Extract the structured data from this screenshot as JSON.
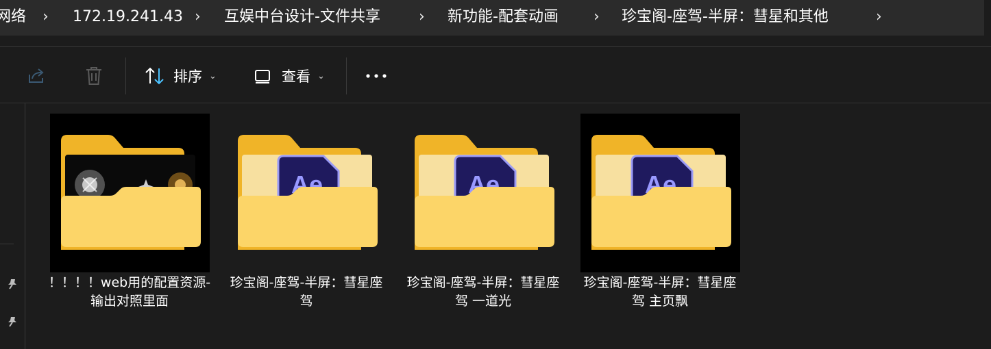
{
  "breadcrumb": {
    "items": [
      "网络",
      "172.19.241.43",
      "互娱中台设计-文件共享",
      "新功能-配套动画",
      "珍宝阁-座驾-半屏：彗星和其他"
    ]
  },
  "toolbar": {
    "sort_label": "排序",
    "view_label": "查看",
    "more_label": "···"
  },
  "files": [
    {
      "name": "！！！！web用的配置资源-输出对照里面",
      "type": "folder-with-preview"
    },
    {
      "name": "珍宝阁-座驾-半屏：彗星座驾",
      "type": "folder-ae",
      "icon_text": "Ae"
    },
    {
      "name": "珍宝阁-座驾-半屏：彗星座驾 一道光",
      "type": "folder-ae",
      "icon_text": "Ae"
    },
    {
      "name": "珍宝阁-座驾-半屏：彗星座驾 主页飘",
      "type": "folder-ae",
      "icon_text": "Ae"
    }
  ],
  "colors": {
    "folder_back": "#f0b428",
    "folder_front": "#fcd568",
    "ae_bg": "#1f1a5e",
    "ae_text": "#9999ff",
    "accent": "#4cc2ff"
  }
}
